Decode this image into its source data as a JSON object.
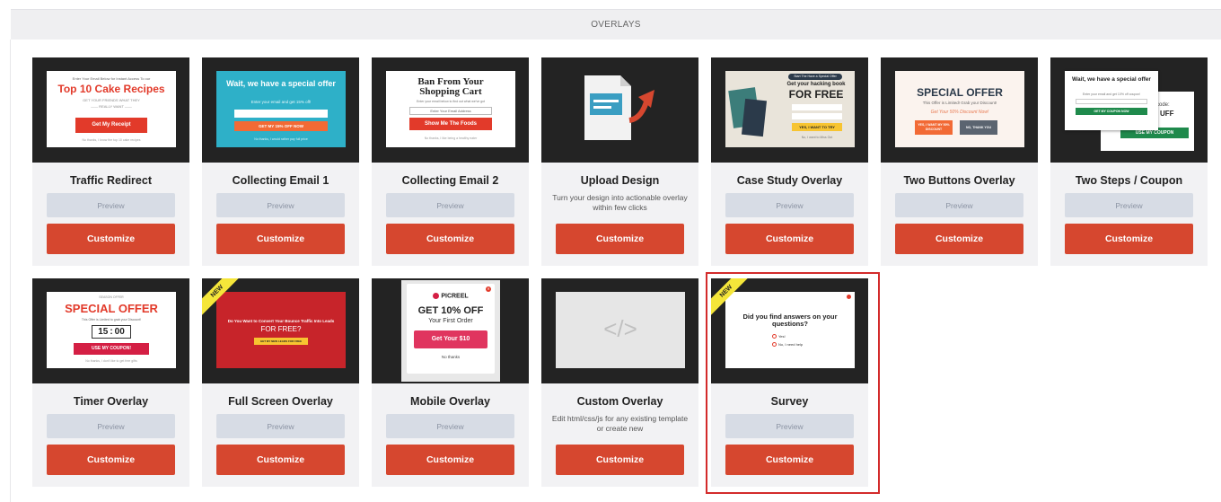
{
  "header": {
    "title": "OVERLAYS"
  },
  "buttons": {
    "preview": "Preview",
    "customize": "Customize"
  },
  "cards": [
    {
      "title": "Traffic Redirect"
    },
    {
      "title": "Collecting Email 1"
    },
    {
      "title": "Collecting Email 2"
    },
    {
      "title": "Upload Design",
      "description": "Turn your design into actionable overlay within few clicks"
    },
    {
      "title": "Case Study Overlay"
    },
    {
      "title": "Two Buttons Overlay"
    },
    {
      "title": "Two Steps / Coupon"
    },
    {
      "title": "Timer Overlay"
    },
    {
      "title": "Full Screen Overlay"
    },
    {
      "title": "Mobile Overlay"
    },
    {
      "title": "Custom Overlay",
      "description": "Edit html/css/js for any existing template or create new"
    },
    {
      "title": "Survey",
      "selected": true
    }
  ],
  "thumbs": {
    "traffic": {
      "headline": "Top 10 Cake Recipes",
      "button": "Get My Receipt"
    },
    "email1": {
      "headline": "Wait, we have a special offer",
      "sub": "Enter your email and get 15% off!",
      "button": "GET MY 15% OFF NOW"
    },
    "email2": {
      "headline": "Ban From Your Shopping Cart",
      "field": "Enter Your Email Address",
      "button": "Show Me The Foods"
    },
    "case": {
      "pill": "Start The Have a Special Offer",
      "headline1": "Get your hacking book",
      "headline2": "FOR FREE",
      "button": "YES, I WANT TO TRY"
    },
    "twobtn": {
      "headline": "SPECIAL OFFER",
      "sub": "This Offer is Limited! Grab your Discount!",
      "sub2": "Get Your 50% Discount Now!",
      "yes": "YES, I WANT MY 50% DISCOUNT",
      "no": "NO, THANK YOU"
    },
    "twostep": {
      "headline": "Wait, we have a special offer",
      "button1": "GET MY COUPON NOW",
      "button2": "USE MY COUPON",
      "code": "code:",
      "codeval": "UFF"
    },
    "timer": {
      "headline": "SPECIAL OFFER",
      "min": "15",
      "sec": "00",
      "button": "USE MY COUPON!"
    },
    "fullscreen": {
      "ribbon": "NEW",
      "headline": "Do You Want to Convert Your Bounce Traffic Into Leads",
      "headline2": "FOR FREE?",
      "button": "GET MY NEW LEADS FOR FREE"
    },
    "mobile": {
      "brand": "PICREEL",
      "headline": "GET 10% OFF",
      "sub": "Your First Order",
      "button": "Get Your $10",
      "no": "No thanks"
    },
    "custom": {
      "glyph": "</>"
    },
    "survey": {
      "ribbon": "NEW",
      "question": "Did you find answers on your questions?",
      "opt1": "Yes!",
      "opt2": "No, I need help"
    }
  }
}
